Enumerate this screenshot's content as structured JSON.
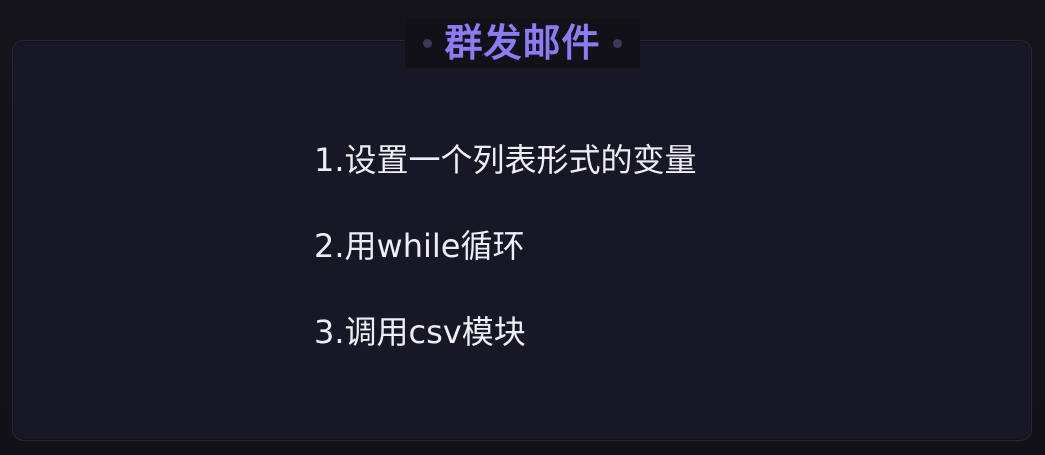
{
  "card": {
    "title": "群发邮件",
    "items": [
      "1.设置一个列表形式的变量",
      "2.用while循环",
      "3.调用csv模块"
    ]
  },
  "colors": {
    "background": "#111117",
    "card_background": "#181726",
    "title": "#8b7cf5",
    "text": "#eeeef6",
    "decorative_dot": "#3b3958"
  }
}
